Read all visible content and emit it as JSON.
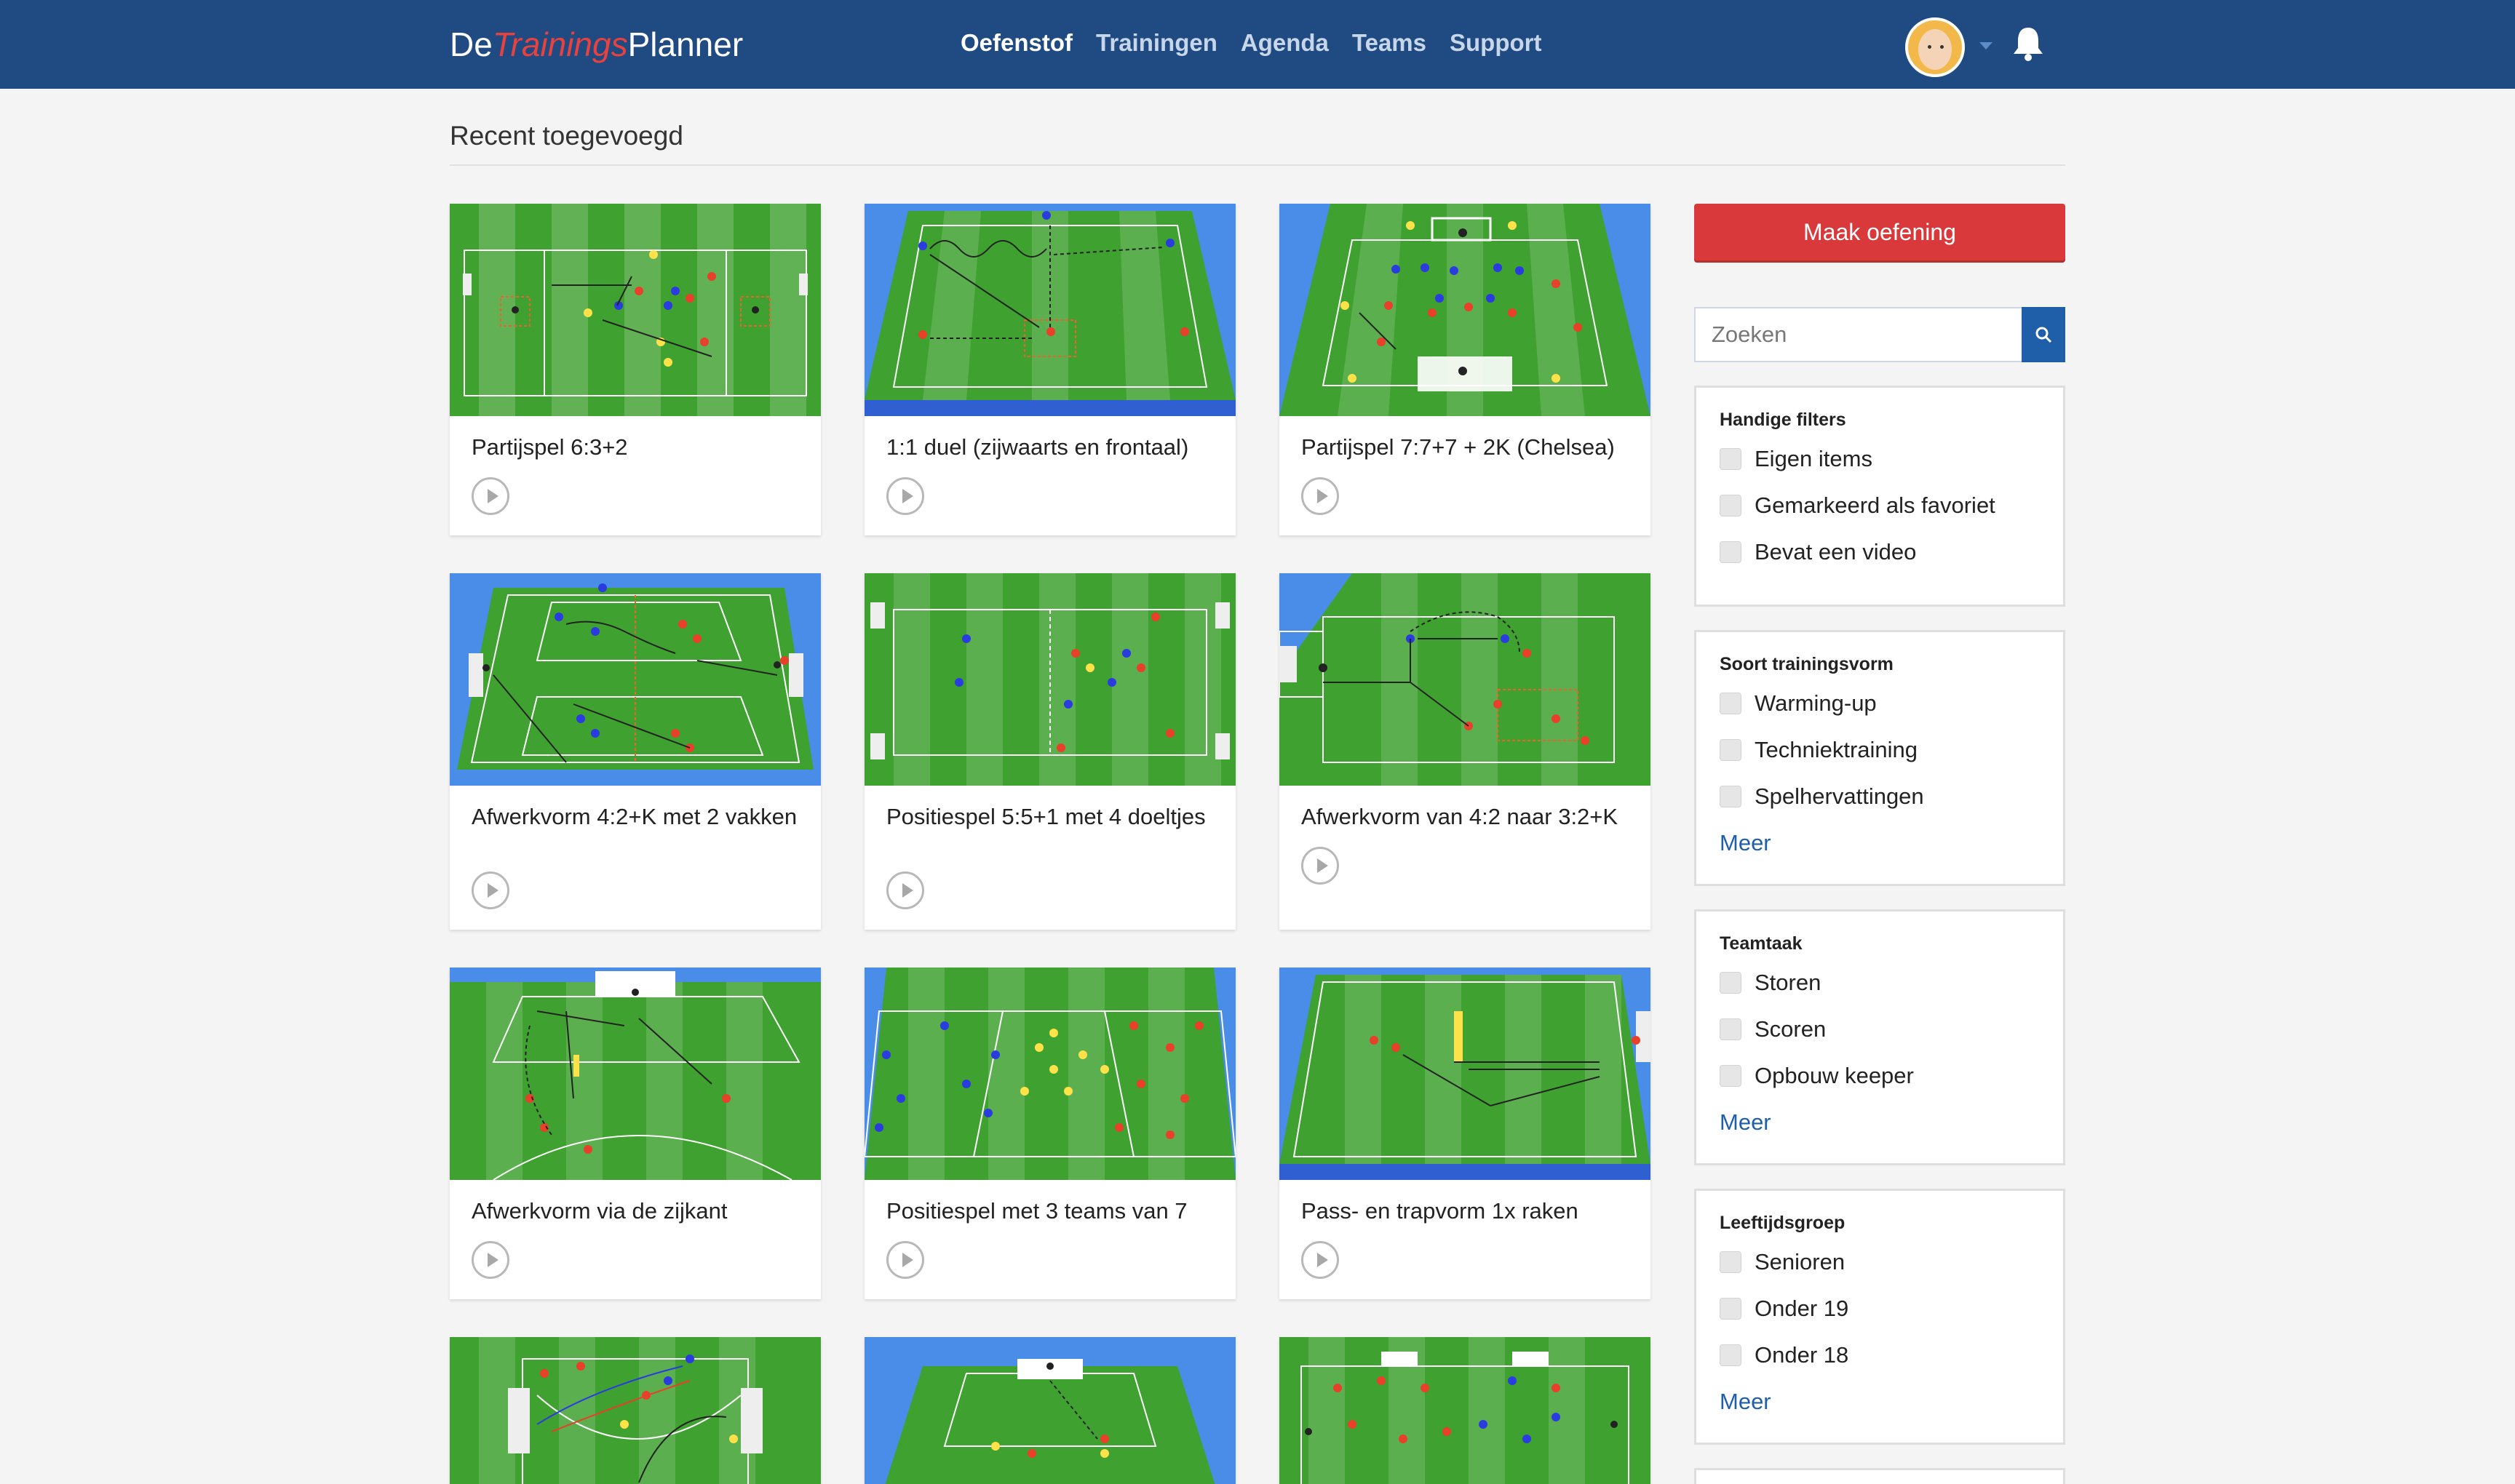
{
  "header": {
    "logo": {
      "part1": "De",
      "part2": "Trainings",
      "part3": "Planner"
    },
    "nav": [
      {
        "label": "Oefenstof",
        "active": true
      },
      {
        "label": "Trainingen",
        "active": false
      },
      {
        "label": "Agenda",
        "active": false
      },
      {
        "label": "Teams",
        "active": false
      },
      {
        "label": "Support",
        "active": false
      }
    ],
    "icons": [
      "avatar",
      "chevron-down-icon",
      "bell-icon"
    ]
  },
  "main": {
    "section_title": "Recent toegevoegd",
    "cards": [
      {
        "title": "Partijspel 6:3+2",
        "has_video": true
      },
      {
        "title": "1:1 duel (zijwaarts en frontaal)",
        "has_video": true
      },
      {
        "title": "Partijspel 7:7+7 + 2K (Chelsea)",
        "has_video": true
      },
      {
        "title": "Afwerkvorm 4:2+K met 2 vakken",
        "has_video": true
      },
      {
        "title": "Positiespel 5:5+1 met 4 doeltjes",
        "has_video": true
      },
      {
        "title": "Afwerkvorm van 4:2 naar 3:2+K",
        "has_video": true
      },
      {
        "title": "Afwerkvorm via de zijkant",
        "has_video": true
      },
      {
        "title": "Positiespel met 3 teams van 7",
        "has_video": true
      },
      {
        "title": "Pass- en trapvorm 1x raken",
        "has_video": true
      },
      {
        "title": "",
        "has_video": false
      },
      {
        "title": "",
        "has_video": false
      },
      {
        "title": "",
        "has_video": false
      }
    ]
  },
  "sidebar": {
    "cta_label": "Maak oefening",
    "search": {
      "placeholder": "Zoeken",
      "value": ""
    },
    "filters": [
      {
        "heading": "Handige filters",
        "options": [
          "Eigen items",
          "Gemarkeerd als favoriet",
          "Bevat een video"
        ],
        "more": ""
      },
      {
        "heading": "Soort trainingsvorm",
        "options": [
          "Warming-up",
          "Techniektraining",
          "Spelhervattingen"
        ],
        "more": "Meer"
      },
      {
        "heading": "Teamtaak",
        "options": [
          "Storen",
          "Scoren",
          "Opbouw keeper"
        ],
        "more": "Meer"
      },
      {
        "heading": "Leeftijdsgroep",
        "options": [
          "Senioren",
          "Onder 19",
          "Onder 18"
        ],
        "more": "Meer"
      }
    ]
  },
  "colors": {
    "header": "#1f4a82",
    "accent": "#d9393a",
    "link": "#1f5ea8",
    "pitch": "#44a832",
    "sky": "#4a8de8"
  }
}
